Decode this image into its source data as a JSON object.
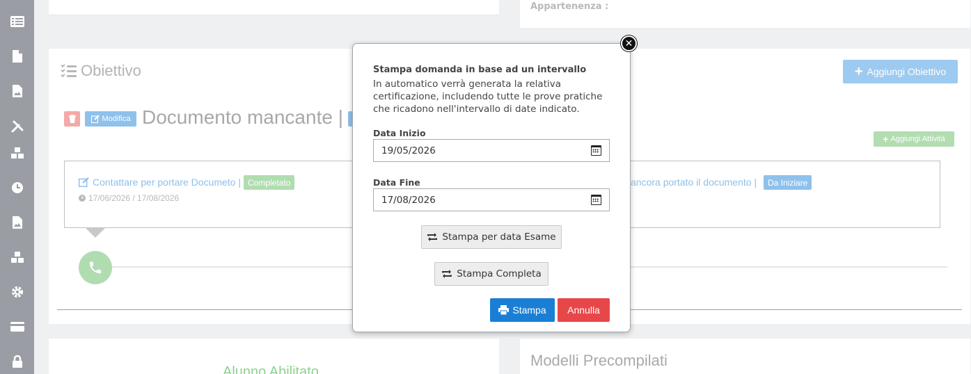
{
  "sidebar": {
    "icons": [
      "list-icon",
      "file-icon",
      "file-image-icon",
      "tools-icon",
      "cubes-icon",
      "clock-icon",
      "file-image-icon",
      "cubes-icon",
      "gear-icon",
      "credit-card-icon",
      "lock-icon"
    ]
  },
  "top_right": {
    "appartenenza_label": "Appartenenza :"
  },
  "objective_panel": {
    "title": "Obiettivo",
    "add_objective_label": "Aggiungi Obiettivo",
    "edit_label": "Modifica",
    "document_title": "Documento mancante |",
    "add_activity_label": "Aggiungi Attività",
    "activities": [
      {
        "label": "Contattare per portare Documeto |",
        "status": "Completato",
        "dates": "17/06/2026 / 17/08/2026"
      },
      {
        "label": "ancora portato il documento |",
        "status": "Da Iniziare"
      }
    ]
  },
  "bottom": {
    "left_title": "Alunno Abilitato",
    "right_title": "Modelli Precompilati"
  },
  "modal": {
    "title": "Stampa domanda in base ad un intervallo",
    "description": "In automatico verrà generata la relativa certificazione, includendo tutte le prove pratiche che ricadono nell'intervallo di date indicato.",
    "start_label": "Data Inizio",
    "start_value": "19/05/2026",
    "end_label": "Data Fine",
    "end_value": "17/08/2026",
    "print_exam_label": "Stampa per data Esame",
    "print_complete_label": "Stampa Completa",
    "print_label": "Stampa",
    "cancel_label": "Annulla"
  },
  "colors": {
    "sidebar": "#9a9ea4",
    "primary": "#1a7fd4",
    "danger": "#e8474a",
    "success_light": "#b0ddb0",
    "info_light": "#8ec1ec"
  }
}
